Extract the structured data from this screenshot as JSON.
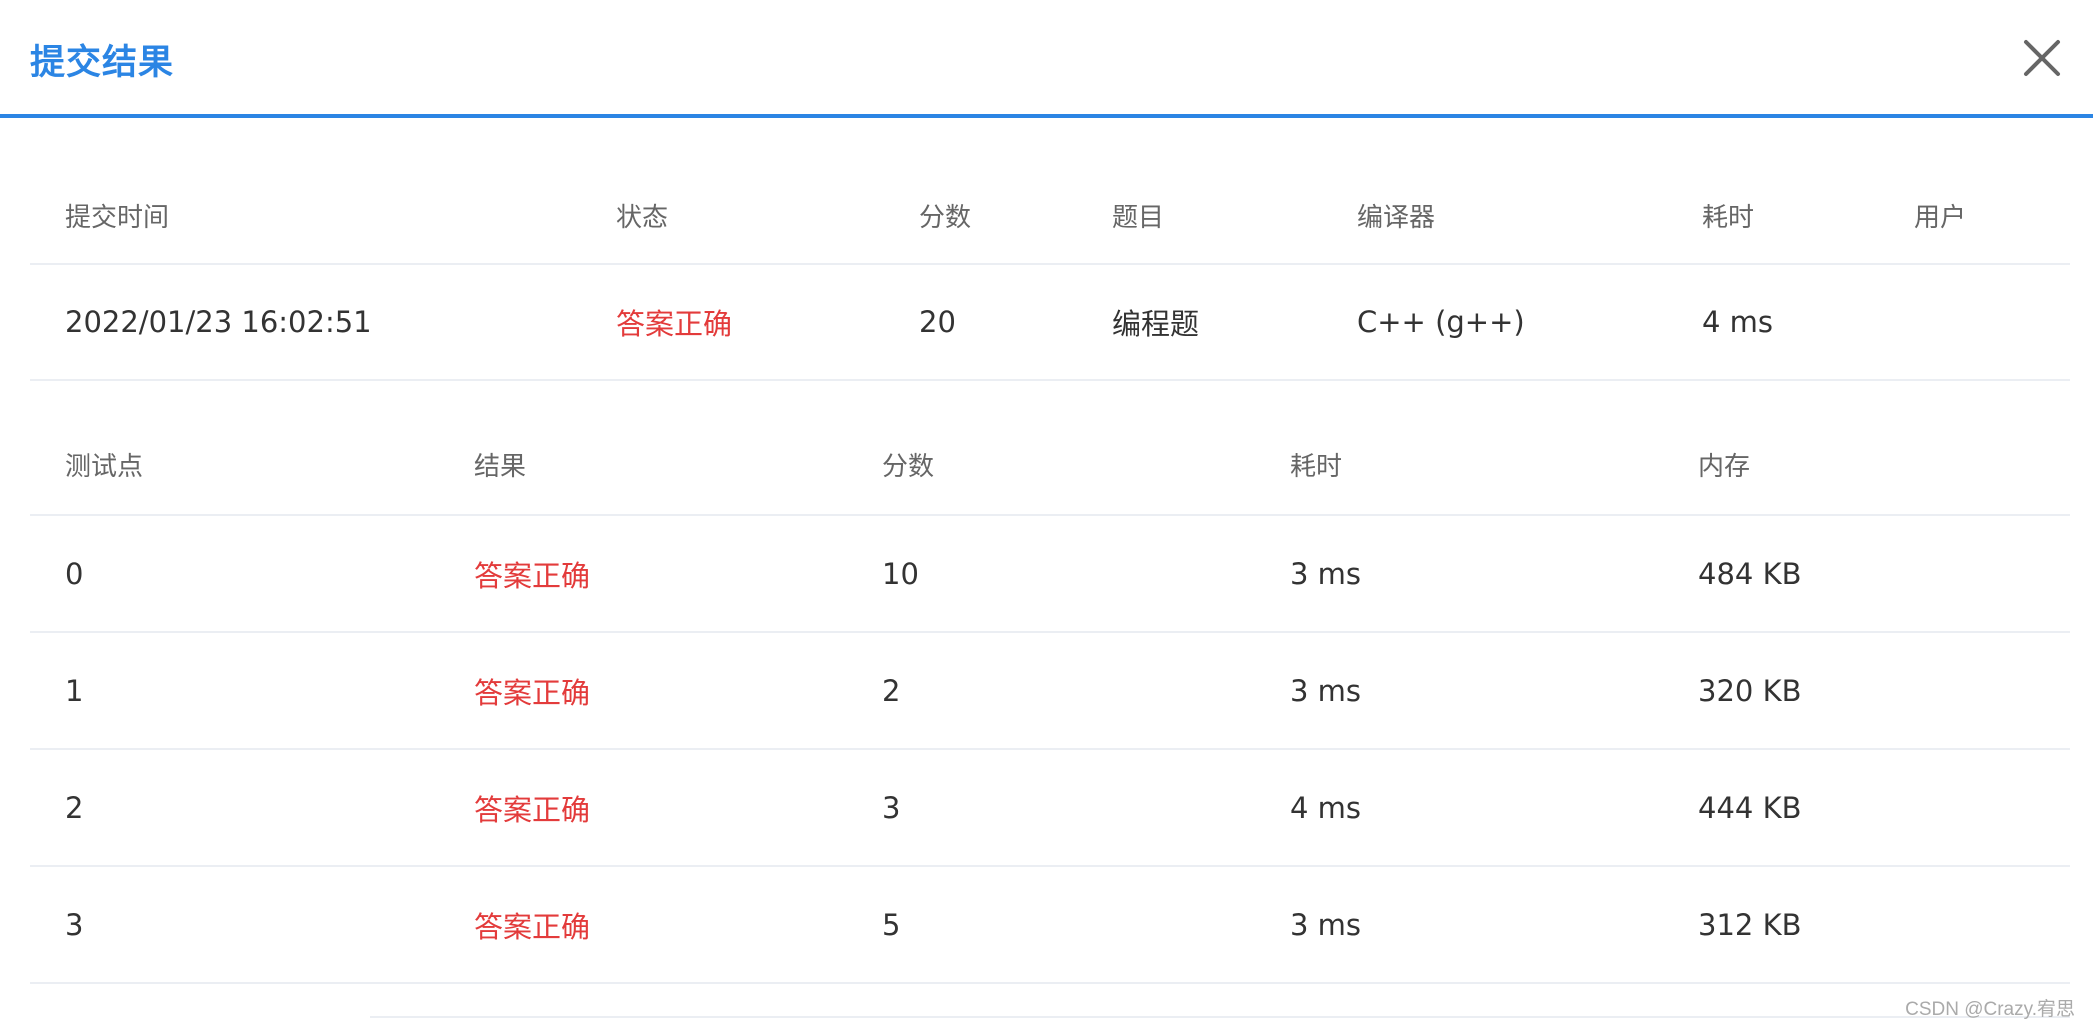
{
  "dialog": {
    "title": "提交结果",
    "close_icon": "close-icon"
  },
  "submission": {
    "headers": [
      "提交时间",
      "状态",
      "分数",
      "题目",
      "编译器",
      "耗时",
      "用户"
    ],
    "row": {
      "time": "2022/01/23 16:02:51",
      "status": "答案正确",
      "score": "20",
      "problem": "编程题",
      "compiler": "C++ (g++)",
      "duration": "4 ms",
      "user": ""
    }
  },
  "testcases": {
    "headers": [
      "测试点",
      "结果",
      "分数",
      "耗时",
      "内存"
    ],
    "rows": [
      {
        "id": "0",
        "result": "答案正确",
        "score": "10",
        "time": "3 ms",
        "memory": "484 KB"
      },
      {
        "id": "1",
        "result": "答案正确",
        "score": "2",
        "time": "3 ms",
        "memory": "320 KB"
      },
      {
        "id": "2",
        "result": "答案正确",
        "score": "3",
        "time": "4 ms",
        "memory": "444 KB"
      },
      {
        "id": "3",
        "result": "答案正确",
        "score": "5",
        "time": "3 ms",
        "memory": "312 KB"
      }
    ]
  },
  "colors": {
    "accent": "#2b85e4",
    "accepted": "#e33b3b",
    "divider": "#ebeef3"
  },
  "watermark": "CSDN @Crazy.宥思"
}
